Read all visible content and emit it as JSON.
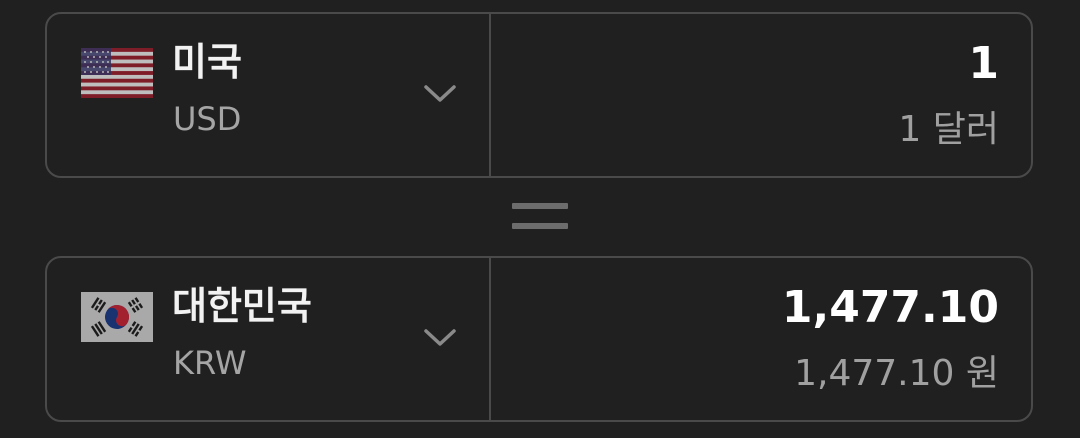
{
  "from": {
    "flag": "us-flag-icon",
    "country": "미국",
    "code": "USD",
    "amount": "1",
    "amount_text": "1 달러"
  },
  "to": {
    "flag": "kr-flag-icon",
    "country": "대한민국",
    "code": "KRW",
    "amount": "1,477.10",
    "amount_text": "1,477.10 원"
  },
  "equals_icon": "equals-icon",
  "dropdown_icon": "chevron-down-icon",
  "colors": {
    "background": "#202020",
    "border": "#4a4a4a",
    "primary_text": "#f2f2f2",
    "secondary_text": "#a0a0a0"
  }
}
